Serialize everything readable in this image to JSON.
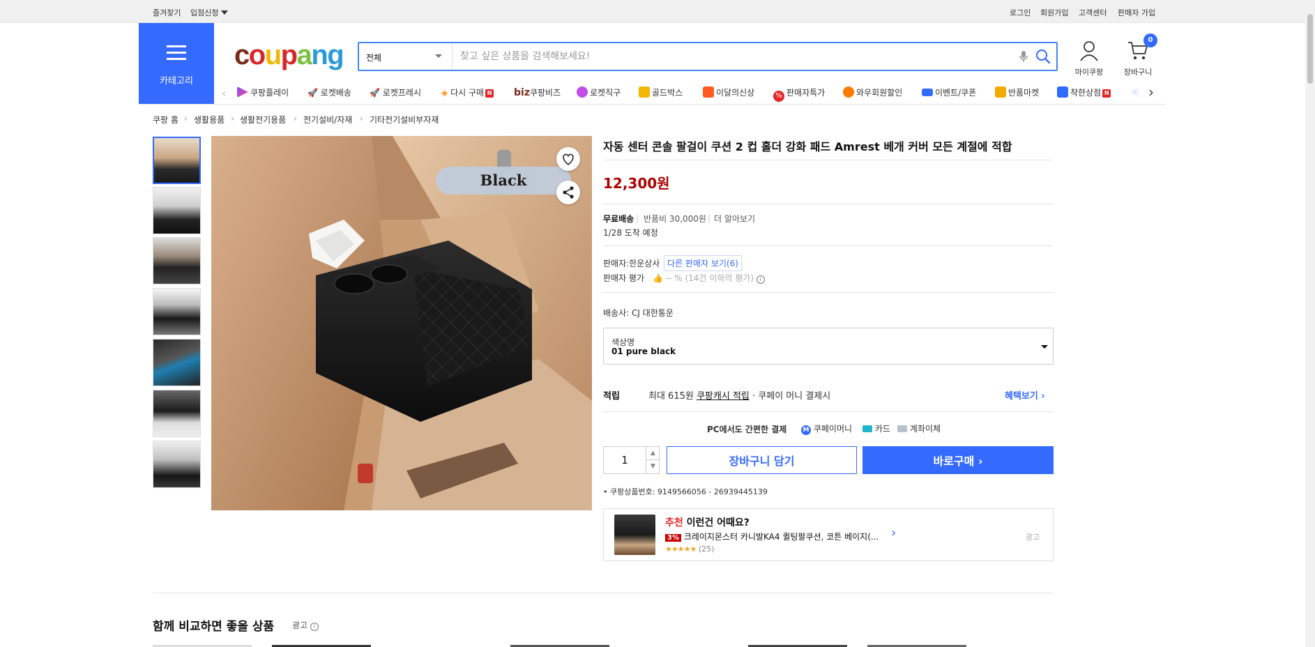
{
  "topbar": {
    "favorites": "즐겨찾기",
    "seller_apply": "입점신청",
    "login": "로그인",
    "signup": "회원가입",
    "customer_center": "고객센터",
    "seller_signup": "판매자 가입"
  },
  "header": {
    "category_label": "카테고리",
    "logo": "coupang",
    "search": {
      "category": "전체",
      "placeholder": "찾고 싶은 상품을 검색해보세요!"
    },
    "my_coupang": "마이쿠팡",
    "cart": "장바구니",
    "cart_count": "0"
  },
  "nav": {
    "items": [
      {
        "label": "쿠팡플레이",
        "color": "#7b4dff"
      },
      {
        "label": "로켓배송",
        "color": "#2f6bff"
      },
      {
        "label": "로켓프레시",
        "color": "#1db954"
      },
      {
        "label": "다시 구매",
        "color": "#ff8a00",
        "badge": "N"
      },
      {
        "label": "쿠팡비즈",
        "prefix": "biz"
      },
      {
        "label": "로켓직구",
        "color": "#c04ee6"
      },
      {
        "label": "골드박스",
        "color": "#f2b705"
      },
      {
        "label": "이달의신상",
        "color": "#ff5a1f"
      },
      {
        "label": "판매자특가",
        "color": "#e52528"
      },
      {
        "label": "와우회원할인",
        "color": "#ff7a00"
      },
      {
        "label": "이벤트/쿠폰",
        "color": "#346aff"
      },
      {
        "label": "반품마켓",
        "color": "#f2a900"
      },
      {
        "label": "착한상점",
        "color": "#2f6bff",
        "badge": "N"
      }
    ]
  },
  "breadcrumb": [
    "쿠팡 홈",
    "생활용품",
    "생활전기용품",
    "전기설비/자재",
    "기타전기설비부자재"
  ],
  "product": {
    "image_label": "Black",
    "title": "자동 센터 콘솔 팔걸이 쿠션 2 컵 홀더 강화 패드 Amrest 베개 커버 모든 계절에 적합",
    "price": "12,300원",
    "shipping_free": "무료배송",
    "return_fee": "반품비 30,000원",
    "learn_more": "더 알아보기",
    "arrival": "1/28 도착 예정",
    "seller_label": "판매자:",
    "seller_name": "한운상사",
    "other_sellers": "다른 판매자 보기(6)",
    "seller_rating_label": "판매자 평가",
    "seller_rating_value": "-- % (14건 이하의 평가)",
    "carrier": "배송사:  CJ 대한통운",
    "option_label": "색상명",
    "option_value": "01 pure black",
    "reward_label": "적립",
    "reward_prefix": "최대 615원",
    "reward_link": "쿠팡캐시 적립",
    "reward_suffix": "· 쿠페이 머니 결제시",
    "benefit_link": "혜택보기",
    "pay_title": "PC에서도 간편한 결제",
    "pay_money": "쿠페이머니",
    "pay_card": "카드",
    "pay_transfer": "계좌이체",
    "quantity": "1",
    "add_to_cart": "장바구니 담기",
    "buy_now": "바로구매",
    "product_code": "쿠팡상품번호: 9149566056 - 26939445139"
  },
  "recommend": {
    "tag": "추천",
    "title": "이런건 어때요?",
    "discount": "3%",
    "name": "크레이지몬스터 카니발KA4 퀼팅팔쿠션, 코튼 베이지(...",
    "reviews": "(25)",
    "ad": "광고"
  },
  "section": {
    "title": "함께 비교하면 좋을 상품",
    "ad": "광고"
  },
  "colors": {
    "accent": "#346aff",
    "price": "#ae0000"
  }
}
